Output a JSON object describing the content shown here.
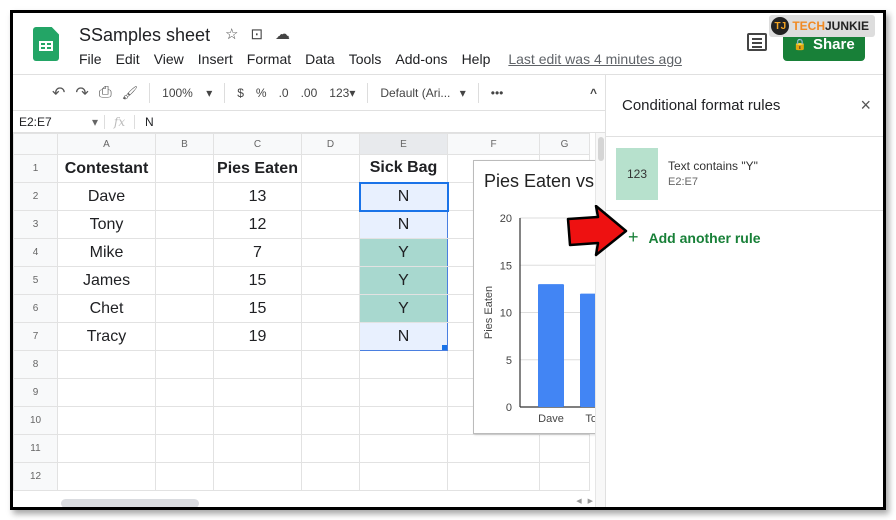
{
  "watermark": {
    "logo": "TJ",
    "brand_a": "TECH",
    "brand_b": "JUNKIE"
  },
  "app": {
    "title": "SSamples sheet",
    "menu": [
      "File",
      "Edit",
      "View",
      "Insert",
      "Format",
      "Data",
      "Tools",
      "Add-ons",
      "Help"
    ],
    "last_edit": "Last edit was 4 minutes ago",
    "share_label": "Share",
    "icons": {
      "star": "☆",
      "folder": "⊡",
      "cloud": "☁",
      "lock": "🔒"
    }
  },
  "toolbar": {
    "undo": "↶",
    "redo": "↷",
    "print": "⎙",
    "paint": "🖌",
    "zoom": "100%",
    "currency": "$",
    "percent": "%",
    "dec_less": ".0",
    "dec_more": ".00",
    "number_format": "123",
    "font": "Default (Ari...",
    "more": "•••",
    "collapse": "^"
  },
  "formula_bar": {
    "name_box": "E2:E7",
    "fx": "fx",
    "value": "N"
  },
  "sheet": {
    "columns": [
      "A",
      "B",
      "C",
      "D",
      "E",
      "F",
      "G"
    ],
    "rows": [
      {
        "n": "1",
        "cells": [
          "Contestant",
          "",
          "Pies Eaten",
          "",
          "Sick Bag",
          "",
          ""
        ]
      },
      {
        "n": "2",
        "cells": [
          "Dave",
          "",
          "13",
          "",
          "N",
          "",
          ""
        ]
      },
      {
        "n": "3",
        "cells": [
          "Tony",
          "",
          "12",
          "",
          "N",
          "",
          ""
        ]
      },
      {
        "n": "4",
        "cells": [
          "Mike",
          "",
          "7",
          "",
          "Y",
          "",
          ""
        ]
      },
      {
        "n": "5",
        "cells": [
          "James",
          "",
          "15",
          "",
          "Y",
          "",
          ""
        ]
      },
      {
        "n": "6",
        "cells": [
          "Chet",
          "",
          "15",
          "",
          "Y",
          "",
          ""
        ]
      },
      {
        "n": "7",
        "cells": [
          "Tracy",
          "",
          "19",
          "",
          "N",
          "",
          ""
        ]
      },
      {
        "n": "8",
        "cells": [
          "",
          "",
          "",
          "",
          "",
          "",
          ""
        ]
      },
      {
        "n": "9",
        "cells": [
          "",
          "",
          "",
          "",
          "",
          "",
          ""
        ]
      },
      {
        "n": "10",
        "cells": [
          "",
          "",
          "",
          "",
          "",
          "",
          ""
        ]
      },
      {
        "n": "11",
        "cells": [
          "",
          "",
          "",
          "",
          "",
          "",
          ""
        ]
      },
      {
        "n": "12",
        "cells": [
          "",
          "",
          "",
          "",
          "",
          "",
          ""
        ]
      }
    ]
  },
  "panel": {
    "title": "Conditional format rules",
    "close": "×",
    "rule": {
      "preview": "123",
      "condition": "Text contains \"Y\"",
      "range": "E2:E7"
    },
    "add_rule": "Add another rule",
    "add_icon": "+"
  },
  "colors": {
    "share_green": "#188038",
    "highlight_y": "#a8d8cf",
    "selection_blue": "#1a73e8",
    "bar_blue": "#4285f4"
  },
  "chart_data": {
    "type": "bar",
    "title": "Pies Eaten vs",
    "xlabel": "",
    "ylabel": "Pies Eaten",
    "categories": [
      "Dave",
      "Tony"
    ],
    "values": [
      13,
      12
    ],
    "ylim": [
      0,
      20
    ],
    "yticks": [
      "0",
      "5",
      "10",
      "15",
      "20"
    ],
    "xtick_labels": [
      "Dave",
      "Tor"
    ],
    "grid": true
  }
}
